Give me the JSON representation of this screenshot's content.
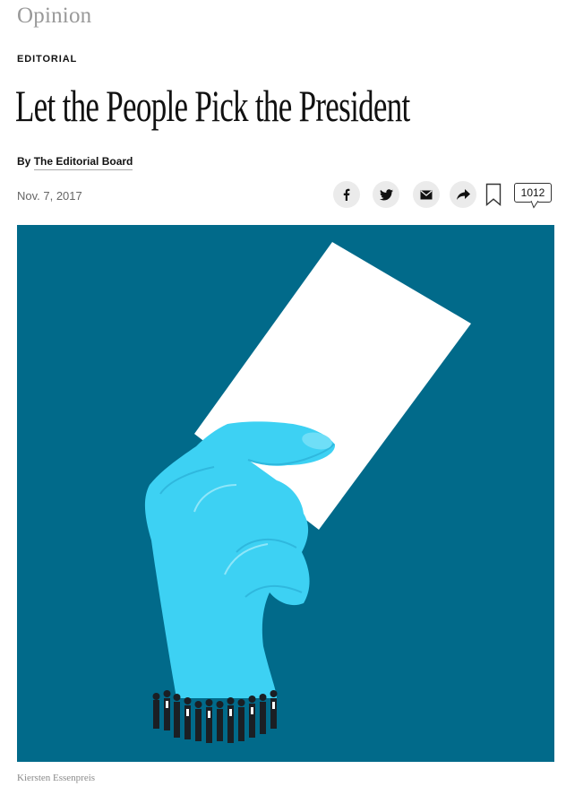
{
  "section": "Opinion",
  "kicker": "EDITORIAL",
  "headline": "Let the People Pick the President",
  "byline": {
    "prefix": "By ",
    "author": "The Editorial Board"
  },
  "date": "Nov. 7, 2017",
  "share": {
    "icons": [
      "facebook-icon",
      "twitter-icon",
      "email-icon",
      "share-arrow-icon",
      "bookmark-icon"
    ],
    "comment_count": "1012"
  },
  "image": {
    "background_color": "#016a8a",
    "hand_color": "#3dd1f3",
    "ballot_color": "#ffffff",
    "credit": "Kiersten Essenpreis"
  }
}
